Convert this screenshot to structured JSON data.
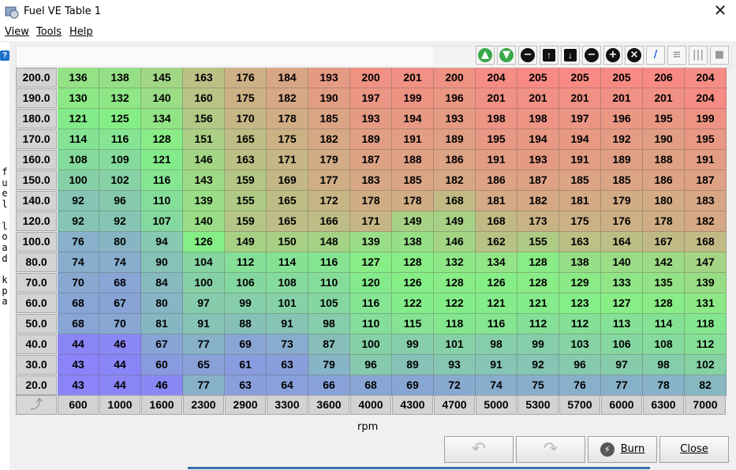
{
  "window": {
    "title": "Fuel VE Table 1",
    "close_glyph": "✕"
  },
  "menu": [
    "View",
    "Tools",
    "Help"
  ],
  "help_badge": "?",
  "toolbar": {
    "buttons": [
      {
        "name": "green-up-icon",
        "glyph": "▲",
        "color": "#3aa84a",
        "style": "circle"
      },
      {
        "name": "green-down-icon",
        "glyph": "▼",
        "color": "#3aa84a",
        "style": "circle"
      },
      {
        "name": "minus-circle-icon",
        "glyph": "−",
        "color": "#111111",
        "style": "circle"
      },
      {
        "name": "arrow-up-icon",
        "glyph": "↑",
        "color": "#111111",
        "style": "square"
      },
      {
        "name": "arrow-down-icon",
        "glyph": "↓",
        "color": "#111111",
        "style": "square"
      },
      {
        "name": "decrement-icon",
        "glyph": "−",
        "color": "#111111",
        "style": "circle"
      },
      {
        "name": "increment-icon",
        "glyph": "+",
        "color": "#111111",
        "style": "circle"
      },
      {
        "name": "clear-icon",
        "glyph": "×",
        "color": "#111111",
        "style": "circle"
      },
      {
        "name": "pencil-icon",
        "glyph": "/",
        "color": "#2b55d6",
        "style": "plain"
      },
      {
        "name": "rows-icon",
        "glyph": "≡",
        "color": "#9a9a9a",
        "style": "plain"
      },
      {
        "name": "columns-icon",
        "glyph": "|||",
        "color": "#9a9a9a",
        "style": "plain"
      },
      {
        "name": "cell-icon",
        "glyph": "■",
        "color": "#9a9a9a",
        "style": "plain"
      }
    ]
  },
  "y_axis_label": "fuel load kpa",
  "x_axis_label": "rpm",
  "load_axis": [
    "200.0",
    "190.0",
    "180.0",
    "170.0",
    "160.0",
    "150.0",
    "140.0",
    "120.0",
    "100.0",
    "80.0",
    "70.0",
    "60.0",
    "50.0",
    "40.0",
    "30.0",
    "20.0"
  ],
  "rpm_axis": [
    "600",
    "1000",
    "1600",
    "2300",
    "2900",
    "3300",
    "3600",
    "4000",
    "4300",
    "4700",
    "5000",
    "5300",
    "5700",
    "6000",
    "6300",
    "7000"
  ],
  "table": [
    [
      136,
      138,
      145,
      163,
      176,
      184,
      193,
      200,
      201,
      200,
      204,
      205,
      205,
      205,
      206,
      204
    ],
    [
      130,
      132,
      140,
      160,
      175,
      182,
      190,
      197,
      199,
      196,
      201,
      201,
      201,
      201,
      201,
      204
    ],
    [
      121,
      125,
      134,
      156,
      170,
      178,
      185,
      193,
      194,
      193,
      198,
      198,
      197,
      196,
      195,
      199
    ],
    [
      114,
      116,
      128,
      151,
      165,
      175,
      182,
      189,
      191,
      189,
      195,
      194,
      194,
      192,
      190,
      195
    ],
    [
      108,
      109,
      121,
      146,
      163,
      171,
      179,
      187,
      188,
      186,
      191,
      193,
      191,
      189,
      188,
      191
    ],
    [
      100,
      102,
      116,
      143,
      159,
      169,
      177,
      183,
      185,
      182,
      186,
      187,
      185,
      185,
      186,
      187
    ],
    [
      92,
      96,
      110,
      139,
      155,
      165,
      172,
      178,
      178,
      168,
      181,
      182,
      181,
      179,
      180,
      183
    ],
    [
      92,
      92,
      107,
      140,
      159,
      165,
      166,
      171,
      149,
      149,
      168,
      173,
      175,
      176,
      178,
      182
    ],
    [
      76,
      80,
      94,
      126,
      149,
      150,
      148,
      139,
      138,
      146,
      162,
      155,
      163,
      164,
      167,
      168
    ],
    [
      74,
      74,
      90,
      104,
      112,
      114,
      116,
      127,
      128,
      132,
      134,
      128,
      138,
      140,
      142,
      147
    ],
    [
      70,
      68,
      84,
      100,
      106,
      108,
      110,
      120,
      126,
      128,
      126,
      128,
      129,
      133,
      135,
      139
    ],
    [
      68,
      67,
      80,
      97,
      99,
      101,
      105,
      116,
      122,
      122,
      121,
      121,
      123,
      127,
      128,
      131
    ],
    [
      68,
      70,
      81,
      91,
      88,
      91,
      98,
      110,
      115,
      118,
      116,
      112,
      112,
      113,
      114,
      118
    ],
    [
      44,
      46,
      67,
      77,
      69,
      73,
      87,
      100,
      99,
      101,
      98,
      99,
      103,
      106,
      108,
      112
    ],
    [
      43,
      44,
      60,
      65,
      61,
      63,
      79,
      96,
      89,
      93,
      91,
      92,
      96,
      97,
      98,
      102
    ],
    [
      43,
      44,
      46,
      77,
      63,
      64,
      66,
      68,
      69,
      72,
      74,
      75,
      76,
      77,
      78,
      82
    ]
  ],
  "buttons": {
    "undo_glyph": "↶",
    "redo_glyph": "↷",
    "burn_label": "Burn",
    "burn_glyph": "⚡",
    "close_label": "Close"
  },
  "colors": {
    "low": "#8a84f8",
    "mid": "#84f086",
    "high": "#f88a84",
    "header": "#d3d3d3"
  }
}
